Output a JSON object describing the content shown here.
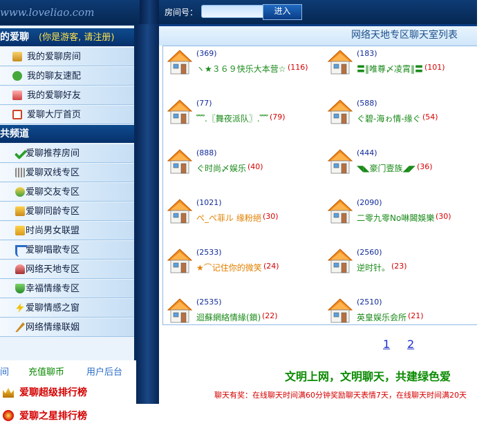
{
  "header": {
    "logo_text": "www.loveliao.com",
    "room_label": "房间号：",
    "room_input_value": "",
    "enter_label": "进入"
  },
  "sidebar": {
    "section1_title": "的爱聊",
    "guest_note": "(你是游客, 请注册)",
    "personal": [
      {
        "label": "我的爱聊房间",
        "icon": "book-icon"
      },
      {
        "label": "我的聊友速配",
        "icon": "puzzle-icon"
      },
      {
        "label": "我的爱聊好友",
        "icon": "friends-icon"
      },
      {
        "label": "爱聊大厅首页",
        "icon": "home-icon"
      }
    ],
    "section2_title": "共频道",
    "channels": [
      {
        "label": "爱聊推荐房间",
        "icon": "checkmark-icon"
      },
      {
        "label": "爱聊双线专区",
        "icon": "grid-icon"
      },
      {
        "label": "爱聊交友专区",
        "icon": "users-icon"
      },
      {
        "label": "爱聊同龄专区",
        "icon": "folder-users-icon"
      },
      {
        "label": "时尚男女联盟",
        "icon": "folder-icon"
      },
      {
        "label": "爱聊唱歌专区",
        "icon": "music-note-icon"
      },
      {
        "label": "网络天地专区",
        "icon": "people-icon"
      },
      {
        "label": "幸福情缘专区",
        "icon": "shield-icon"
      },
      {
        "label": "爱聊情感之窗",
        "icon": "lightning-icon"
      },
      {
        "label": "网络情缘联姻",
        "icon": "key-icon"
      }
    ],
    "bottom_links": [
      "间",
      "充值聊币",
      "用户后台"
    ],
    "rankings": [
      {
        "label": "爱聊超级排行榜",
        "icon": "crown-icon"
      },
      {
        "label": "爱聊之星排行榜",
        "icon": "star-medal-icon"
      }
    ]
  },
  "content": {
    "title": "网络天地专区聊天室列表",
    "rooms": [
      {
        "count": "(369)",
        "name": "ヽ★３６９快乐大本营☆",
        "num": "(116)",
        "color": "#1a8a1a"
      },
      {
        "count": "(183)",
        "name": "〓‖唯尊〆凌霄‖〓",
        "num": "(101)",
        "color": "#1a8a1a"
      },
      {
        "count": "(77)",
        "name": "﹌.〖舞夜派队〗.﹌",
        "num": "(79)",
        "color": "#1a8a1a"
      },
      {
        "count": "(588)",
        "name": "ぐ碧-海ゎ情-缘ぐ",
        "num": "(54)",
        "color": "#1a8a1a"
      },
      {
        "count": "(888)",
        "name": "ぐ时尚〆娱乐",
        "num": "(40)",
        "color": "#1a8a1a"
      },
      {
        "count": "(444)",
        "name": "◥◣豪门壹族◢◤",
        "num": "(36)",
        "color": "#1a8a1a"
      },
      {
        "count": "(1021)",
        "name": "ぺ_ぺ菲ル 缘粉絕",
        "num": "(30)",
        "color": "#e08000"
      },
      {
        "count": "(2090)",
        "name": "二零九零No啉閪娛樂",
        "num": "(30)",
        "color": "#1a8a1a"
      },
      {
        "count": "(2533)",
        "name": "★⌒记住你的微笑",
        "num": "(24)",
        "color": "#e08000"
      },
      {
        "count": "(2560)",
        "name": "逆时针。",
        "num": "(23)",
        "color": "#1a8a1a"
      },
      {
        "count": "(2535)",
        "name": "迴蘇網絡情緣(鎖)",
        "num": "(22)",
        "color": "#1a8a1a"
      },
      {
        "count": "(2510)",
        "name": "英皇娱乐会所",
        "num": "(21)",
        "color": "#1a8a1a"
      }
    ],
    "pages": [
      "1",
      "2"
    ],
    "slogan": "文明上网，文明聊天，共建绿色爱",
    "notice": "聊天有奖：在线聊天时间满60分钟奖励聊天表情7天，在线聊天时间满20天"
  }
}
